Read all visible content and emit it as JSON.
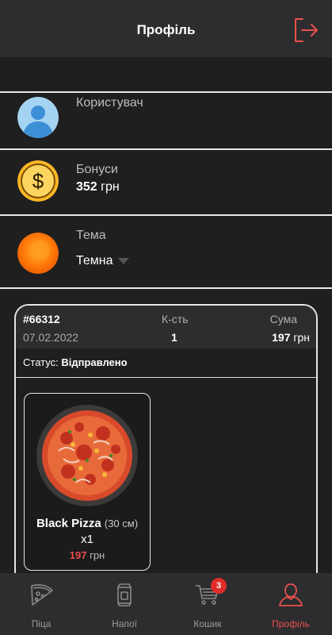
{
  "header": {
    "title": "Профіль",
    "logout_icon": "logout-icon"
  },
  "profile": {
    "user_label": "Користувач",
    "bonus_label": "Бонуси",
    "bonus_amount": "352",
    "bonus_currency": "грн",
    "theme_label": "Тема",
    "theme_value": "Темна"
  },
  "order": {
    "number": "#66312",
    "date": "07.02.2022",
    "qty_header": "К-сть",
    "qty_value": "1",
    "sum_header": "Сума",
    "sum_value": "197",
    "sum_currency": "грн",
    "status_label": "Статус:",
    "status_value": "Відправлено",
    "items": [
      {
        "name": "Black Pizza",
        "size": "(30 см)",
        "qty": "x1",
        "price": "197",
        "currency": "грн"
      }
    ]
  },
  "nav": {
    "items": [
      {
        "label": "Піца",
        "icon": "pizza-icon"
      },
      {
        "label": "Напої",
        "icon": "drink-can-icon"
      },
      {
        "label": "Кошик",
        "icon": "cart-icon",
        "badge": "3"
      },
      {
        "label": "Профіль",
        "icon": "user-icon"
      }
    ]
  },
  "colors": {
    "accent": "#e94f4f",
    "background": "#1f1f20",
    "bar": "#2d2d2f"
  }
}
